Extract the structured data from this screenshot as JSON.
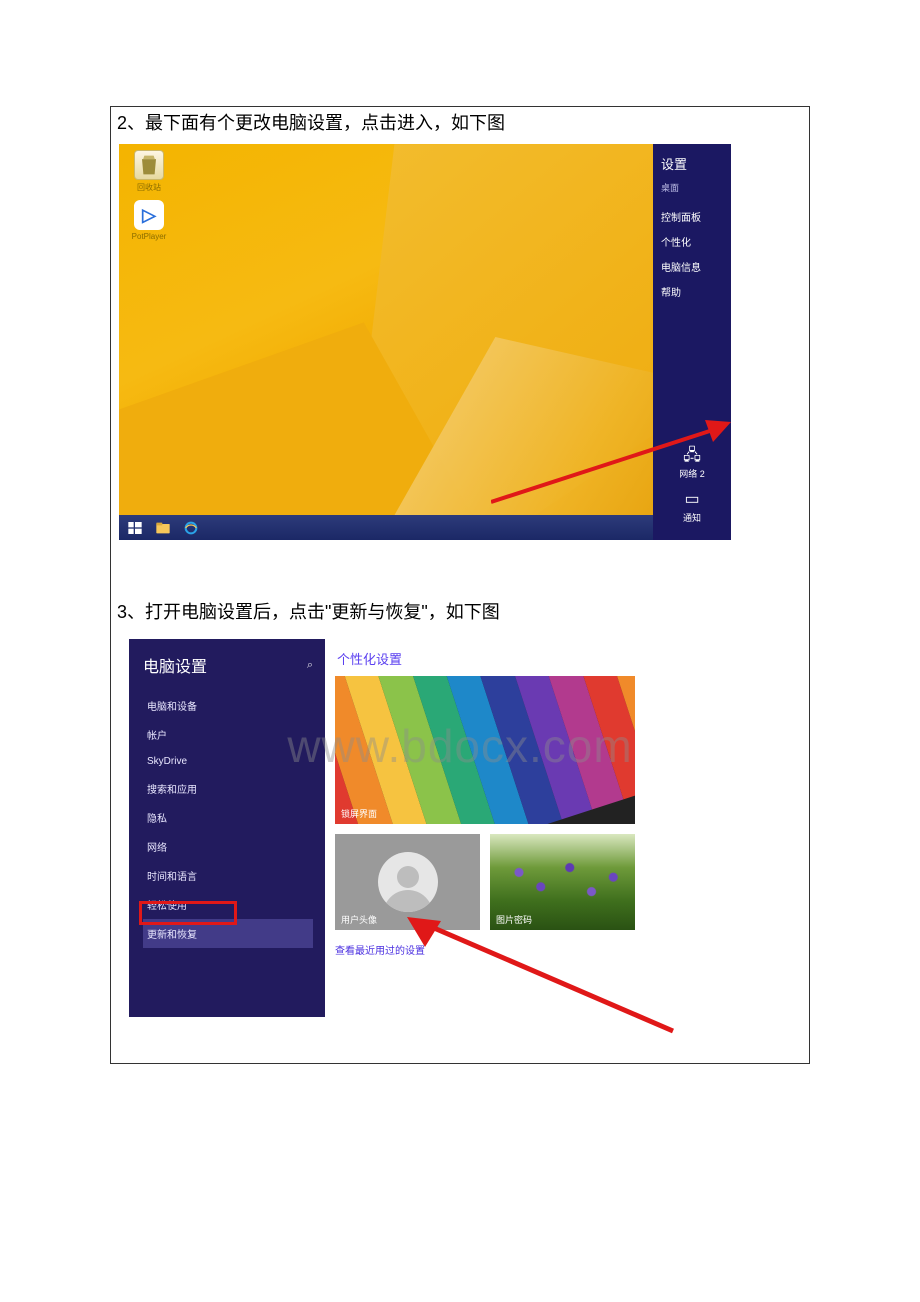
{
  "step2": {
    "text": "2、最下面有个更改电脑设置，点击进入，如下图"
  },
  "step3": {
    "text": "3、打开电脑设置后，点击\"更新与恢复\"，如下图"
  },
  "watermark": "www.bdocx.com",
  "desktop": {
    "icons": {
      "recycle": "回收站",
      "potplayer": "PotPlayer"
    }
  },
  "charms": {
    "title": "设置",
    "subtitle": "桌面",
    "items": [
      "控制面板",
      "个性化",
      "电脑信息",
      "帮助"
    ],
    "tiles": {
      "network": "网络 2",
      "notify": "通知"
    }
  },
  "pcsettings": {
    "header": "电脑设置",
    "menu": [
      "电脑和设备",
      "帐户",
      "SkyDrive",
      "搜索和应用",
      "隐私",
      "网络",
      "时间和语言",
      "轻松使用",
      "更新和恢复"
    ],
    "panel": {
      "heading": "个性化设置",
      "tiles": {
        "lock": "锁屏界面",
        "avatar": "用户头像",
        "picpwd": "图片密码"
      },
      "recent": "查看最近用过的设置"
    }
  }
}
